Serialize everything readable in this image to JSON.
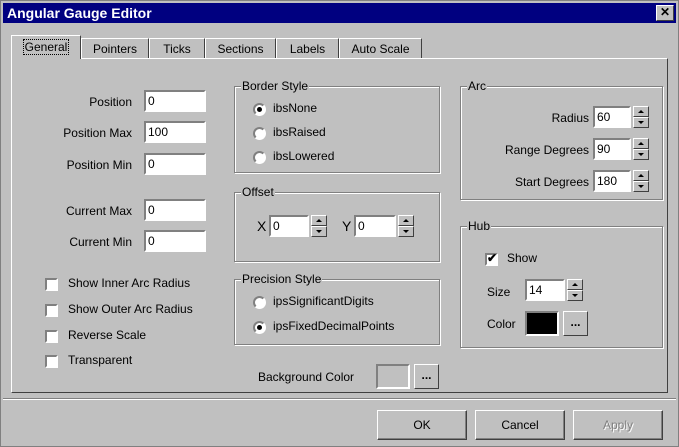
{
  "window": {
    "title": "Angular Gauge Editor",
    "close_label": "✕"
  },
  "tabs": [
    {
      "label": "General",
      "active": true
    },
    {
      "label": "Pointers"
    },
    {
      "label": "Ticks"
    },
    {
      "label": "Sections"
    },
    {
      "label": "Labels"
    },
    {
      "label": "Auto Scale"
    }
  ],
  "general": {
    "position": {
      "label": "Position",
      "value": "0"
    },
    "position_max": {
      "label": "Position Max",
      "value": "100"
    },
    "position_min": {
      "label": "Position Min",
      "value": "0"
    },
    "current_max": {
      "label": "Current Max",
      "value": "0"
    },
    "current_min": {
      "label": "Current Min",
      "value": "0"
    },
    "checkboxes": [
      {
        "label": "Show Inner Arc Radius",
        "checked": false
      },
      {
        "label": "Show Outer Arc Radius",
        "checked": false
      },
      {
        "label": "Reverse Scale",
        "checked": false
      },
      {
        "label": "Transparent",
        "checked": false
      }
    ]
  },
  "border_style": {
    "title": "Border Style",
    "options": [
      {
        "label": "ibsNone",
        "selected": true
      },
      {
        "label": "ibsRaised",
        "selected": false
      },
      {
        "label": "ibsLowered",
        "selected": false
      }
    ]
  },
  "offset": {
    "title": "Offset",
    "x_label": "X",
    "x_value": "0",
    "y_label": "Y",
    "y_value": "0"
  },
  "precision_style": {
    "title": "Precision Style",
    "options": [
      {
        "label": "ipsSignificantDigits",
        "selected": false
      },
      {
        "label": "ipsFixedDecimalPoints",
        "selected": true
      }
    ]
  },
  "background": {
    "label": "Background Color",
    "color": "#c0c0c0",
    "dots": "..."
  },
  "arc": {
    "title": "Arc",
    "radius": {
      "label": "Radius",
      "value": "60"
    },
    "range_degrees": {
      "label": "Range Degrees",
      "value": "90"
    },
    "start_degrees": {
      "label": "Start Degrees",
      "value": "180"
    }
  },
  "hub": {
    "title": "Hub",
    "show_label": "Show",
    "show_checked": true,
    "size_label": "Size",
    "size_value": "14",
    "color_label": "Color",
    "color": "#000000",
    "dots": "..."
  },
  "buttons": {
    "ok": "OK",
    "cancel": "Cancel",
    "apply": "Apply"
  }
}
